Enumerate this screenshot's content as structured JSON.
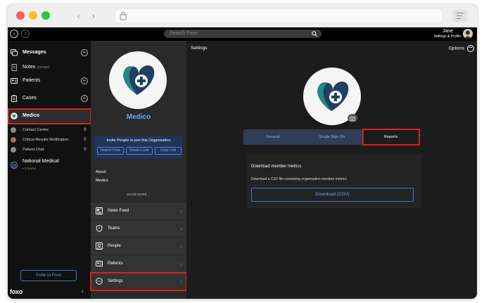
{
  "browser": {
    "back_icon": "chevron-left-icon",
    "forward_icon": "chevron-right-icon",
    "lock_icon": "lock-icon",
    "menu_icon": "hamburger-icon",
    "traffic_lights": {
      "close": "#ff5f57",
      "minimize": "#febc2e",
      "maximize": "#28c840"
    }
  },
  "topbar": {
    "search_placeholder": "Search Foxo",
    "user_name": "Jane",
    "user_subtitle": "Settings & Profile"
  },
  "sidebar": {
    "items": [
      {
        "label": "Messages",
        "icon": "messages-icon",
        "has_add": true
      },
      {
        "label": "Notes",
        "label_suffix": "(private)",
        "icon": "note-icon",
        "has_add": false
      },
      {
        "label": "Patients",
        "icon": "patient-card-icon",
        "has_add": true
      },
      {
        "label": "Cases",
        "icon": "clipboard-icon",
        "has_add": true
      },
      {
        "label": "Medico",
        "icon": "org-avatar-icon",
        "has_add": false
      }
    ],
    "channels": [
      {
        "label": "Contact Centre",
        "pinned": true
      },
      {
        "label": "Critical Results Notification",
        "pinned": true
      },
      {
        "label": "Patient Chat",
        "pinned": true
      }
    ],
    "org": {
      "name": "National Medical",
      "meta": "• 3 teams"
    },
    "invite_label": "Invite to Foxo",
    "logo_text": "foxo"
  },
  "middle": {
    "org_name": "Medico",
    "invite_title": "Invite People to join this Organisation",
    "invite_buttons": [
      "Search Foxo",
      "Email a Link",
      "Copy Link"
    ],
    "about_heading": "About",
    "about_value": "Medico",
    "show_more": "SHOW MORE ⌄",
    "nav": [
      {
        "label": "News Feed",
        "icon": "newspaper-icon"
      },
      {
        "label": "Teams",
        "icon": "shield-icon"
      },
      {
        "label": "People",
        "icon": "person-icon"
      },
      {
        "label": "Patients",
        "icon": "patient-card-icon"
      },
      {
        "label": "Settings",
        "icon": "settings-icon"
      }
    ]
  },
  "main": {
    "title": "Settings",
    "options_label": "Options",
    "tabs": [
      {
        "label": "General",
        "active": false
      },
      {
        "label": "Single Sign On",
        "active": false
      },
      {
        "label": "Reports",
        "active": true
      }
    ],
    "panel": {
      "title": "Download member metrics",
      "description": "Download a CSV file containing organisation member metrics",
      "button_label": "Download (CSV)"
    }
  },
  "colors": {
    "accent_blue": "#6ca5f0",
    "highlight_red": "#e11d1d",
    "logo_teal": "#1f8a83",
    "logo_navy": "#1f3f63"
  }
}
